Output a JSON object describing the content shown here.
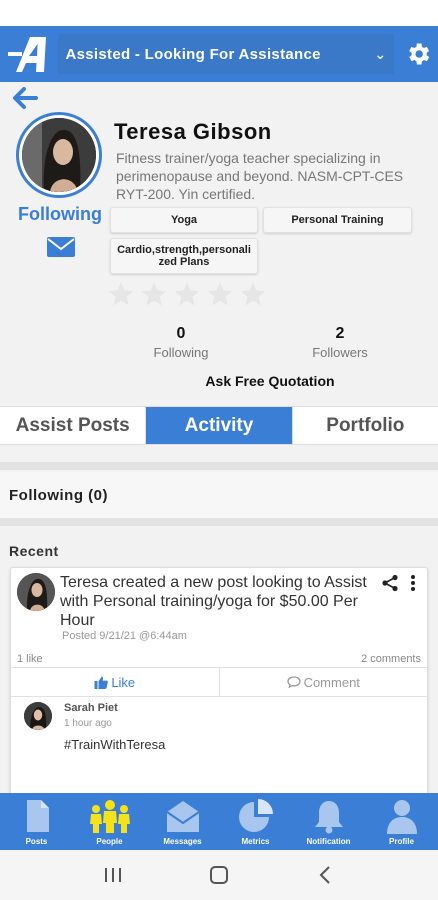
{
  "header": {
    "mode_label": "Assisted - Looking For Assistance"
  },
  "profile": {
    "name": "Teresa  Gibson",
    "bio": "Fitness trainer/yoga teacher specializing in perimenopause and beyond. NASM-CPT-CES  RYT-200.  Yin certified.",
    "following_link": "Following",
    "tags": [
      "Yoga",
      "Personal Training",
      "Cardio,strength,personalized Plans"
    ],
    "rating_stars": 5,
    "rating_filled": 0,
    "stats": {
      "following_count": "0",
      "following_label": "Following",
      "followers_count": "2",
      "followers_label": "Followers"
    },
    "quote_button": "Ask Free Quotation"
  },
  "tabs": [
    {
      "label": "Assist Posts",
      "active": false
    },
    {
      "label": "Activity",
      "active": true
    },
    {
      "label": "Portfolio",
      "active": false
    }
  ],
  "following_section": "Following (0)",
  "recent_label": "Recent",
  "post": {
    "text": "Teresa  created a new post looking to Assist with Personal training/yoga  for $50.00 Per Hour",
    "date": "Posted 9/21/21 @6:44am",
    "likes": "1 like",
    "comments": "2 comments",
    "like_label": "Like",
    "comment_label": "Comment",
    "comment": {
      "author": "Sarah Piet",
      "time": "1 hour ago",
      "body": "#TrainWithTeresa"
    }
  },
  "bottom_nav": [
    {
      "label": "Posts",
      "icon": "document-icon"
    },
    {
      "label": "People",
      "icon": "people-icon",
      "active": true
    },
    {
      "label": "Messages",
      "icon": "envelope-icon"
    },
    {
      "label": "Metrics",
      "icon": "pie-chart-icon"
    },
    {
      "label": "Notification",
      "icon": "bell-icon"
    },
    {
      "label": "Profile",
      "icon": "user-icon"
    }
  ],
  "colors": {
    "primary": "#3a7fd5",
    "active_nav_icon": "#f5e21b",
    "nav_icon": "#a9c6ee"
  }
}
